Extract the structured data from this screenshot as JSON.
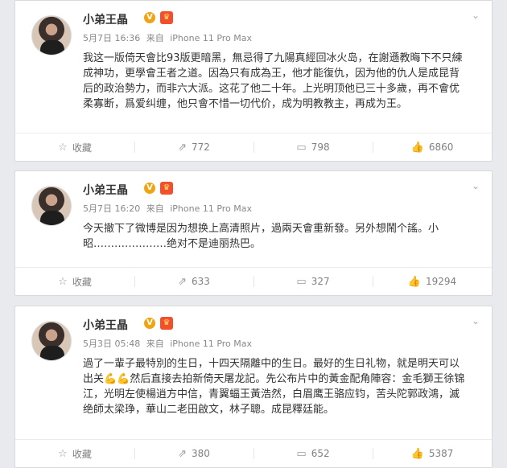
{
  "colors": {
    "accent": "#f0a414",
    "vip": "#f34f2c",
    "text": "#333333",
    "muted": "#808080"
  },
  "posts": [
    {
      "username": "小弟王晶",
      "time": "5月7日 16:36",
      "source_prefix": "来自",
      "source": "iPhone 11 Pro Max",
      "text": "我这一版倚天會比93版更暗黑，無忌得了九陽真經回冰火岛，在謝遜教晦下不只練成神功，更學會王者之道。因為只有成為王，他才能復仇，因为他的仇人是成昆背后的政治勢力，而非六大派。这花了他二十年。上光明顶他已三十多歲，再不會优柔寡断，爲爱纠缠，他只會不惜一切代价，成为明教教主，再成为王。",
      "actions": {
        "favorite": "收藏",
        "repost": "772",
        "comment": "798",
        "like": "6860"
      }
    },
    {
      "username": "小弟王晶",
      "time": "5月7日 16:20",
      "source_prefix": "来自",
      "source": "iPhone 11 Pro Max",
      "text": "今天撤下了微博是因为想换上高清照片，過兩天會重新發。另外想鬧个謠。小昭…………………绝对不是迪丽热巴。",
      "actions": {
        "favorite": "收藏",
        "repost": "633",
        "comment": "327",
        "like": "19294"
      }
    },
    {
      "username": "小弟王晶",
      "time": "5月3日 05:48",
      "source_prefix": "来自",
      "source": "iPhone 11 Pro Max",
      "text": "過了一輩子最特別的生日，十四天隔離中的生日。最好的生日礼物，就是明天可以出关💪💪然后直接去拍新倚天屠龙記。先公布片中的黃金配角陣容：金毛獅王徐锦江，光明左使楊逍方中信，青翼蝠王黃浩然，白眉鹰王骆应钧，苦头陀郭政鴻，滅绝師太梁琤，華山二老田啟文，林子聰。成昆釋廷能。",
      "actions": {
        "favorite": "收藏",
        "repost": "380",
        "comment": "652",
        "like": "5387"
      }
    }
  ]
}
